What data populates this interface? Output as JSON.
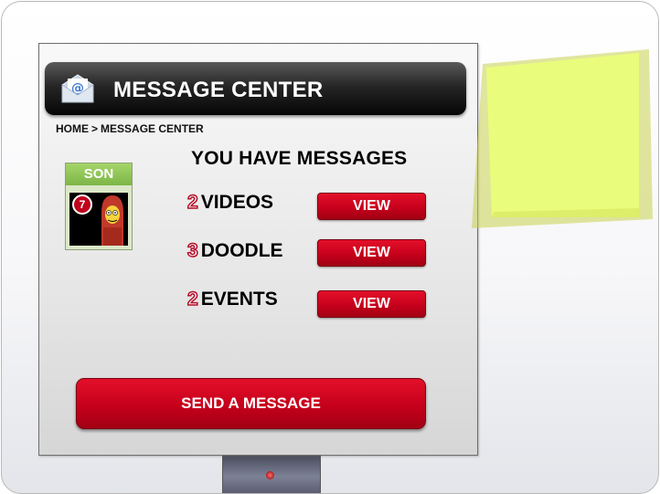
{
  "header": {
    "title": "MESSAGE CENTER",
    "icon": "mail-icon"
  },
  "breadcrumb": {
    "home": "HOME",
    "separator": ">",
    "current": "MESSAGE CENTER"
  },
  "profile": {
    "name": "SON",
    "badge_count": "7"
  },
  "messages": {
    "heading": "YOU HAVE MESSAGES",
    "items": [
      {
        "count": "2",
        "label": "VIDEOS",
        "button": "VIEW"
      },
      {
        "count": "3",
        "label": "DOODLE",
        "button": "VIEW"
      },
      {
        "count": "2",
        "label": "EVENTS",
        "button": "VIEW"
      }
    ]
  },
  "actions": {
    "send_label": "SEND A MESSAGE"
  },
  "colors": {
    "accent_red": "#c6001b",
    "profile_green": "#7cb646",
    "sticky_yellow": "#eafc7b",
    "header_black": "#050505"
  }
}
